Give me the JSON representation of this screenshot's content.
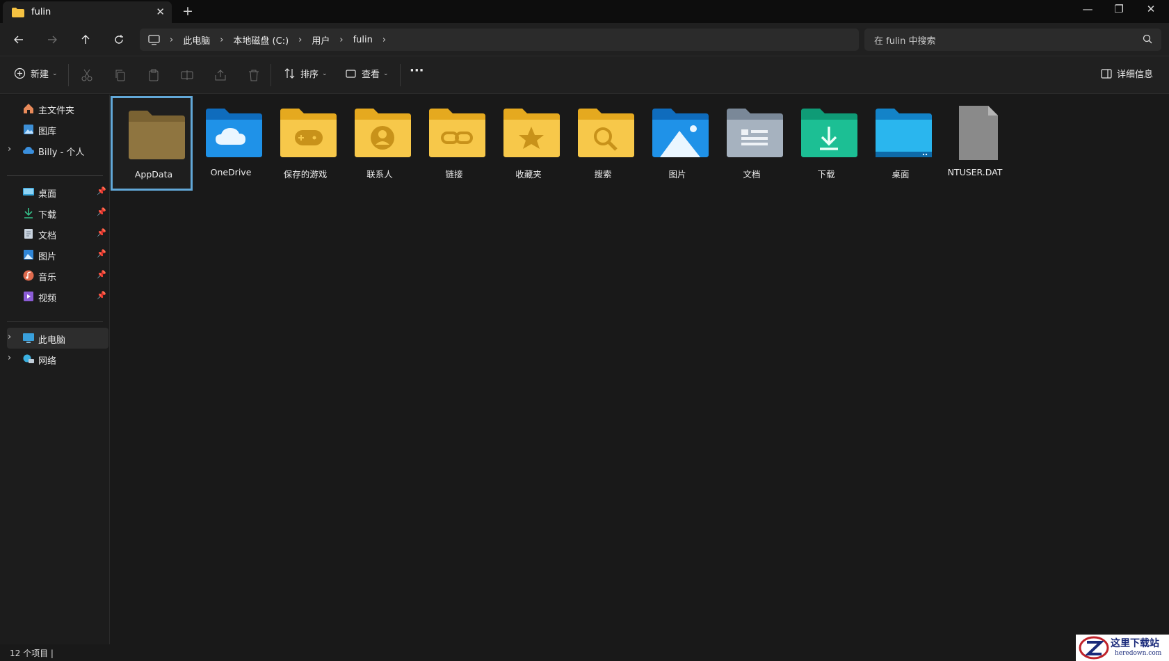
{
  "window": {
    "tab_title": "fulin",
    "new_tab": "+",
    "close_tab": "✕",
    "minimize": "—",
    "maximize": "❐",
    "close": "✕"
  },
  "breadcrumb": [
    "此电脑",
    "本地磁盘 (C:)",
    "用户",
    "fulin"
  ],
  "search": {
    "placeholder": "在 fulin 中搜索"
  },
  "toolbar": {
    "new_label": "新建",
    "sort_label": "排序",
    "view_label": "查看",
    "more_label": "···",
    "details_label": "详细信息"
  },
  "sidebar": {
    "quick": [
      {
        "label": "主文件夹",
        "icon": "home-icon"
      },
      {
        "label": "图库",
        "icon": "gallery-icon"
      },
      {
        "label": "Billy - 个人",
        "icon": "onedrive-cloud-icon"
      }
    ],
    "pinned": [
      {
        "label": "桌面",
        "icon": "desktop-icon"
      },
      {
        "label": "下载",
        "icon": "download-icon"
      },
      {
        "label": "文档",
        "icon": "document-icon"
      },
      {
        "label": "图片",
        "icon": "pictures-icon"
      },
      {
        "label": "音乐",
        "icon": "music-icon"
      },
      {
        "label": "视频",
        "icon": "video-icon"
      }
    ],
    "devices": [
      {
        "label": "此电脑",
        "icon": "computer-icon"
      },
      {
        "label": "网络",
        "icon": "network-icon"
      }
    ]
  },
  "items": [
    {
      "name": "AppData",
      "icon": "hidden-folder-icon"
    },
    {
      "name": "OneDrive",
      "icon": "onedrive-folder-icon"
    },
    {
      "name": "保存的游戏",
      "icon": "saved-games-folder-icon"
    },
    {
      "name": "联系人",
      "icon": "contacts-folder-icon"
    },
    {
      "name": "链接",
      "icon": "links-folder-icon"
    },
    {
      "name": "收藏夹",
      "icon": "favorites-folder-icon"
    },
    {
      "name": "搜索",
      "icon": "searches-folder-icon"
    },
    {
      "name": "图片",
      "icon": "pictures-folder-icon"
    },
    {
      "name": "文档",
      "icon": "documents-folder-icon"
    },
    {
      "name": "下载",
      "icon": "downloads-folder-icon"
    },
    {
      "name": "桌面",
      "icon": "desktop-folder-icon"
    },
    {
      "name": "NTUSER.DAT",
      "icon": "file-icon"
    }
  ],
  "status": {
    "count": "12 个项目  |"
  },
  "watermark": {
    "text": "这里下载站",
    "sub": "heredown.com"
  },
  "colors": {
    "accent": "#62a8d8",
    "folder_yellow": "#f6c23c",
    "folder_blue": "#1a8be0"
  }
}
